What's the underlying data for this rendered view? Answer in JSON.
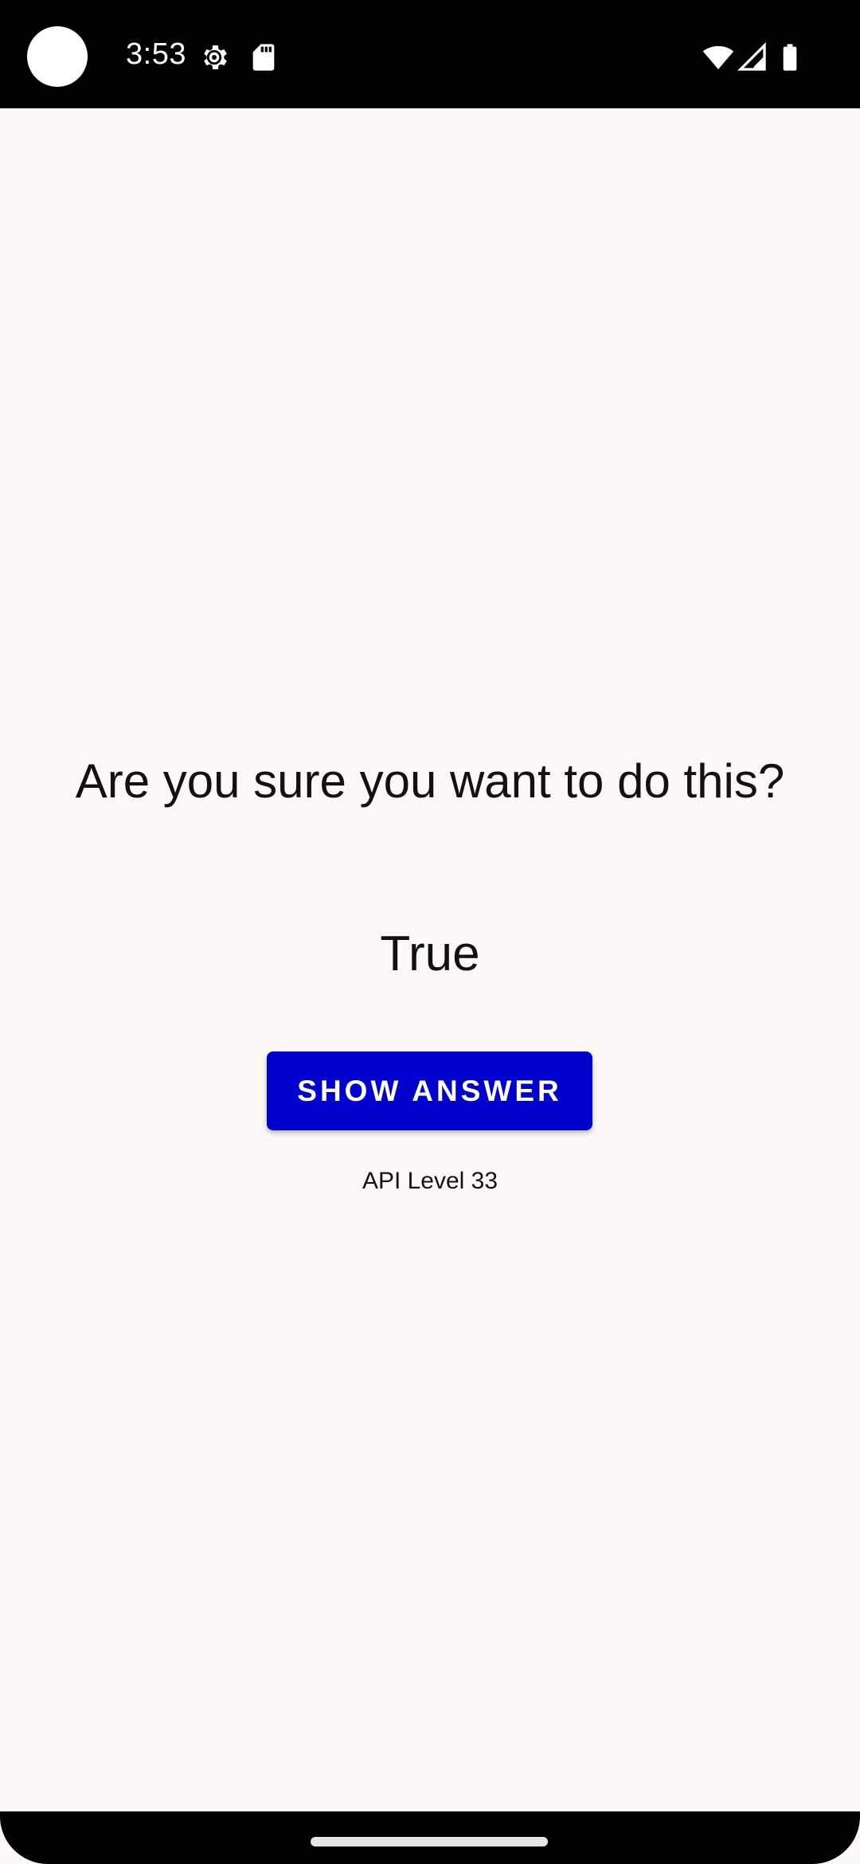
{
  "status_bar": {
    "time": "3:53",
    "icons": [
      "settings-icon",
      "sd-card-icon",
      "wifi-icon",
      "signal-icon",
      "battery-icon"
    ]
  },
  "main": {
    "question": "Are you sure you want to do this?",
    "answer": "True",
    "show_answer_label": "SHOW ANSWER",
    "api_level": "API Level 33"
  },
  "colors": {
    "background": "#fcf8f7",
    "button": "#0000cc",
    "button_text": "#ffffff"
  }
}
